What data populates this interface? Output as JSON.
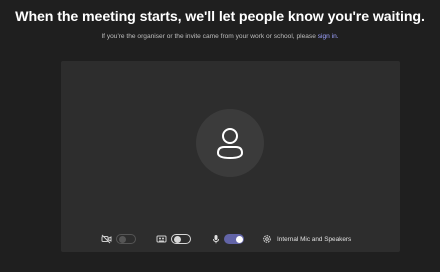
{
  "header": {
    "title": "When the meeting starts, we'll let people know you're waiting.",
    "subtitle_prefix": "If you're the organiser or the invite came from your work or school, please",
    "signin_link": "sign in."
  },
  "preview": {
    "avatar_icon": "person-icon"
  },
  "controls": {
    "camera": {
      "icon": "camera-off-icon",
      "enabled": false,
      "state": "disabled"
    },
    "background_effects": {
      "icon": "background-effects-icon",
      "state": "off"
    },
    "microphone": {
      "icon": "microphone-icon",
      "state": "on"
    },
    "device_settings": {
      "icon": "gear-icon",
      "label": "Internal Mic and Speakers"
    }
  },
  "colors": {
    "background": "#1f1f1f",
    "preview_panel": "#2d2d2d",
    "link": "#9ea2ff",
    "toggle_on": "#6264a7"
  }
}
